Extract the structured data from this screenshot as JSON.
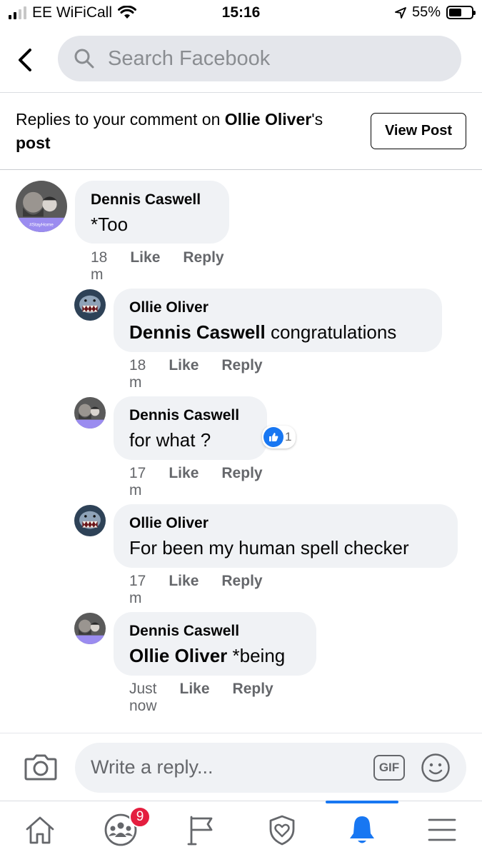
{
  "status_bar": {
    "carrier": "EE WiFiCall",
    "time": "15:16",
    "battery": "55%",
    "battery_level": 0.55
  },
  "search": {
    "placeholder": "Search Facebook"
  },
  "context": {
    "prefix": "Replies to your comment on ",
    "author": "Ollie Oliver",
    "suffix": "'s",
    "last_word": "post",
    "view_post_label": "View Post"
  },
  "comments": [
    {
      "author": "Dennis Caswell",
      "text": "*Too",
      "mention": "",
      "time": "18 m",
      "like_label": "Like",
      "reply_label": "Reply"
    },
    {
      "author": "Ollie Oliver",
      "mention": "Dennis Caswell",
      "text": " congratulations",
      "time": "18 m",
      "like_label": "Like",
      "reply_label": "Reply"
    },
    {
      "author": "Dennis Caswell",
      "mention": "",
      "text": "for what ?",
      "time": "17 m",
      "like_label": "Like",
      "reply_label": "Reply",
      "reaction_count": "1"
    },
    {
      "author": "Ollie Oliver",
      "mention": "",
      "text": "For been my human spell checker",
      "time": "17 m",
      "like_label": "Like",
      "reply_label": "Reply"
    },
    {
      "author": "Dennis Caswell",
      "mention": "Ollie Oliver",
      "text": " *being",
      "time": "Just now",
      "like_label": "Like",
      "reply_label": "Reply"
    }
  ],
  "avatar_badge_text": "#StayHome",
  "composer": {
    "placeholder": "Write a reply...",
    "gif_label": "GIF"
  },
  "tabbar": {
    "groups_badge": "9",
    "active_tab": "notifications"
  },
  "colors": {
    "accent": "#1877f2",
    "badge": "#e41e3f",
    "bubble": "#f0f2f5",
    "secondary_text": "#65676b"
  }
}
